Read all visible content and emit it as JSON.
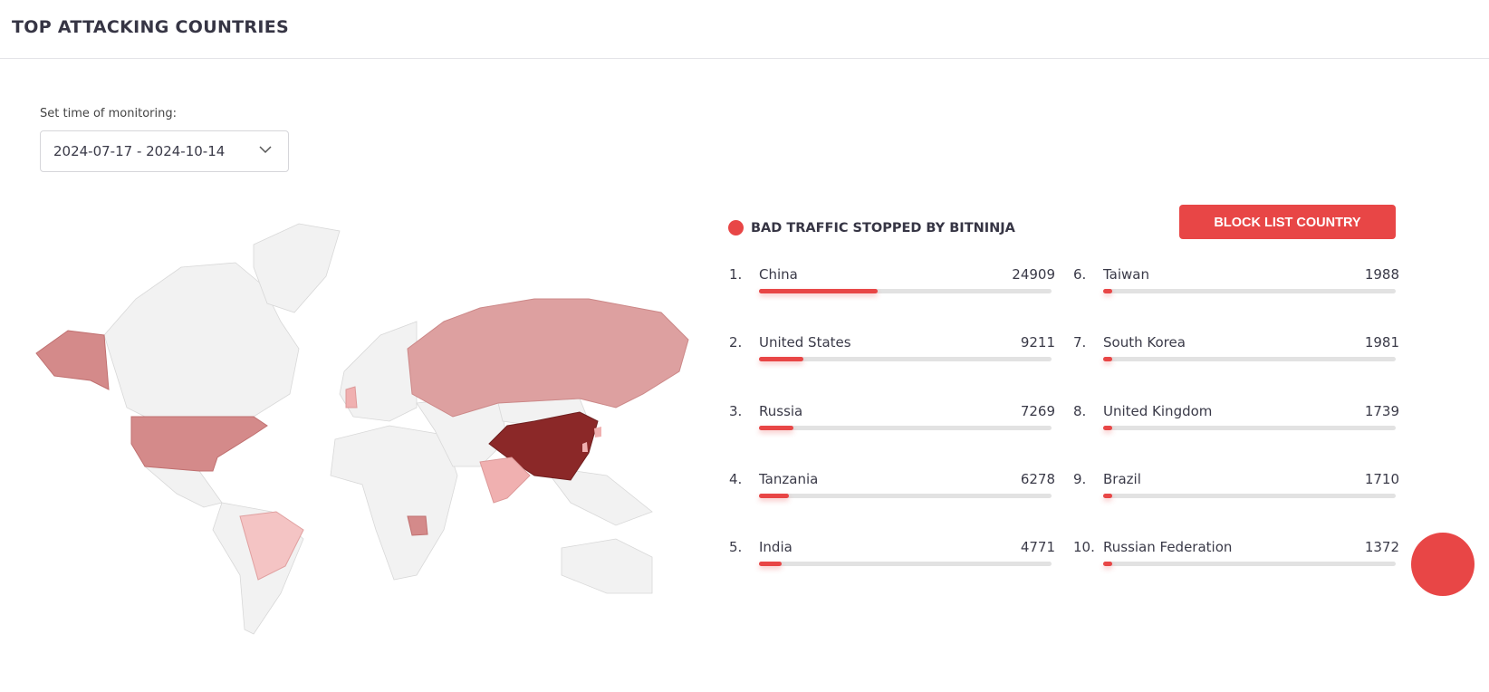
{
  "header": {
    "title": "TOP ATTACKING COUNTRIES"
  },
  "filter": {
    "label": "Set time of monitoring:",
    "value": "2024-07-17 - 2024-10-14"
  },
  "legend": {
    "label": "BAD TRAFFIC STOPPED BY BITNINJA",
    "color": "#e84646"
  },
  "block_button": {
    "label": "BLOCK LIST COUNTRY"
  },
  "countries": [
    {
      "rank": "1.",
      "name": "China",
      "value": 24909
    },
    {
      "rank": "2.",
      "name": "United States",
      "value": 9211
    },
    {
      "rank": "3.",
      "name": "Russia",
      "value": 7269
    },
    {
      "rank": "4.",
      "name": "Tanzania",
      "value": 6278
    },
    {
      "rank": "5.",
      "name": "India",
      "value": 4771
    },
    {
      "rank": "6.",
      "name": "Taiwan",
      "value": 1988
    },
    {
      "rank": "7.",
      "name": "South Korea",
      "value": 1981
    },
    {
      "rank": "8.",
      "name": "United Kingdom",
      "value": 1739
    },
    {
      "rank": "9.",
      "name": "Brazil",
      "value": 1710
    },
    {
      "rank": "10.",
      "name": "Russian Federation",
      "value": 1372
    }
  ],
  "colors": {
    "accent": "#e84646",
    "map_base": "#f2f2f2",
    "map_high": "#8b2828",
    "map_mid": "#d48a8a",
    "map_low": "#f4c4c4"
  }
}
